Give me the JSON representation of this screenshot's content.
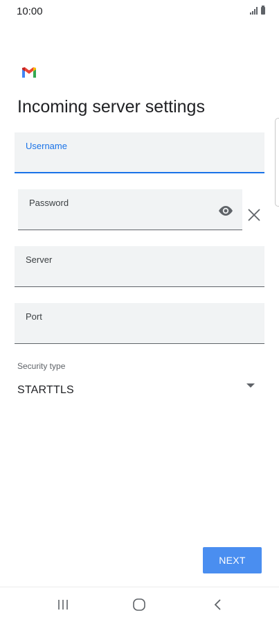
{
  "status_bar": {
    "time": "10:00",
    "icons": [
      "signal-icon",
      "battery-icon"
    ]
  },
  "app": {
    "logo": "gmail-logo",
    "colors": {
      "accent": "#1a73e8",
      "button": "#4a8ef0"
    }
  },
  "page": {
    "title": "Incoming server settings"
  },
  "fields": {
    "username": {
      "label": "Username",
      "value": ""
    },
    "password": {
      "label": "Password",
      "value": "",
      "icons": [
        "eye-icon",
        "clear-icon"
      ]
    },
    "server": {
      "label": "Server",
      "value": ""
    },
    "port": {
      "label": "Port",
      "value": ""
    }
  },
  "security": {
    "label": "Security type",
    "value": "STARTTLS"
  },
  "actions": {
    "next_label": "NEXT"
  },
  "nav": {
    "buttons": [
      "recents-icon",
      "home-icon",
      "back-icon"
    ]
  }
}
